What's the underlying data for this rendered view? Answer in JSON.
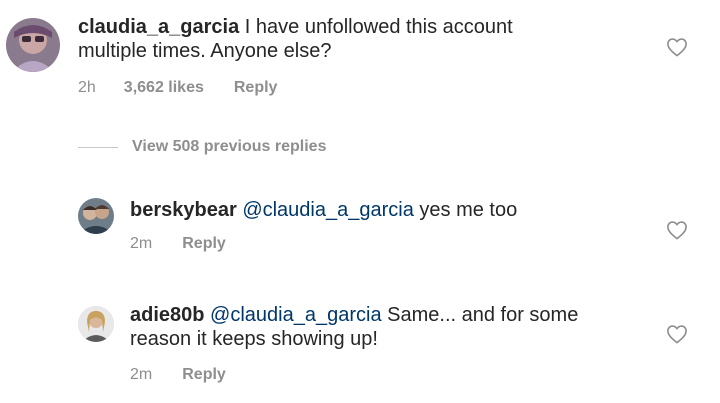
{
  "comments": [
    {
      "username": "claudia_a_garcia",
      "mention": "",
      "text": " I have unfollowed this account multiple times. Anyone else?",
      "time": "2h",
      "likes": "3,662 likes",
      "reply": "Reply"
    }
  ],
  "view_replies": {
    "label": "View 508 previous replies"
  },
  "replies": [
    {
      "username": "berskybear",
      "mention": "@claudia_a_garcia",
      "text": " yes me too",
      "time": "2m",
      "reply": "Reply"
    },
    {
      "username": "adie80b",
      "mention": "@claudia_a_garcia",
      "text": " Same... and for some reason it keeps showing up!",
      "time": "2m",
      "reply": "Reply"
    }
  ],
  "icons": {
    "like": "heart-outline-icon"
  },
  "colors": {
    "text": "#262626",
    "secondary": "#8e8e8e",
    "mention": "#00376b"
  }
}
